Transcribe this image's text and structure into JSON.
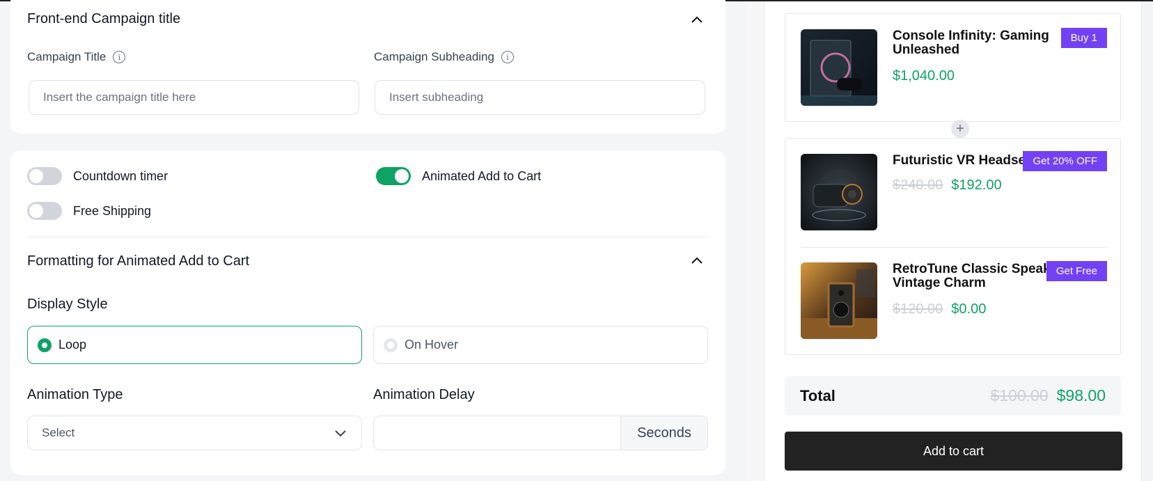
{
  "settings": {
    "campaign_section": {
      "title": "Front-end Campaign title",
      "campaign_title_label": "Campaign Title",
      "campaign_title_placeholder": "Insert the campaign title here",
      "campaign_subheading_label": "Campaign Subheading",
      "campaign_subheading_placeholder": "Insert subheading"
    },
    "toggles": [
      {
        "label": "Countdown timer",
        "on": false
      },
      {
        "label": "Free Shipping",
        "on": false
      },
      {
        "label": "Animated Add to Cart",
        "on": true
      }
    ],
    "formatting": {
      "title": "Formatting for Animated Add to Cart",
      "display_style_label": "Display Style",
      "display_options": [
        {
          "label": "Loop",
          "selected": true
        },
        {
          "label": "On Hover",
          "selected": false
        }
      ],
      "animation_type_label": "Animation Type",
      "animation_type_value": "Select",
      "animation_delay_label": "Animation Delay",
      "animation_delay_value": "",
      "animation_delay_unit": "Seconds"
    }
  },
  "preview": {
    "products": [
      {
        "name_line1": "Console Infinity: Gaming",
        "name_line2": "Unleashed",
        "badge": "Buy 1",
        "old_price": "",
        "price": "$1,040.00"
      },
      {
        "name_line1": "Futuristic VR Headset",
        "name_line2": "",
        "badge": "Get 20% OFF",
        "old_price": "$240.00",
        "price": "$192.00"
      },
      {
        "name_line1": "RetroTune Classic Speaker:",
        "name_line2": "Vintage Charm",
        "badge": "Get Free",
        "old_price": "$120.00",
        "price": "$0.00"
      }
    ],
    "total_label": "Total",
    "total_old": "$100.00",
    "total_new": "$98.00",
    "add_to_cart_label": "Add to cart"
  },
  "colors": {
    "accent_green": "#0ea365",
    "badge_purple": "#7341f5",
    "button_dark": "#222222"
  }
}
